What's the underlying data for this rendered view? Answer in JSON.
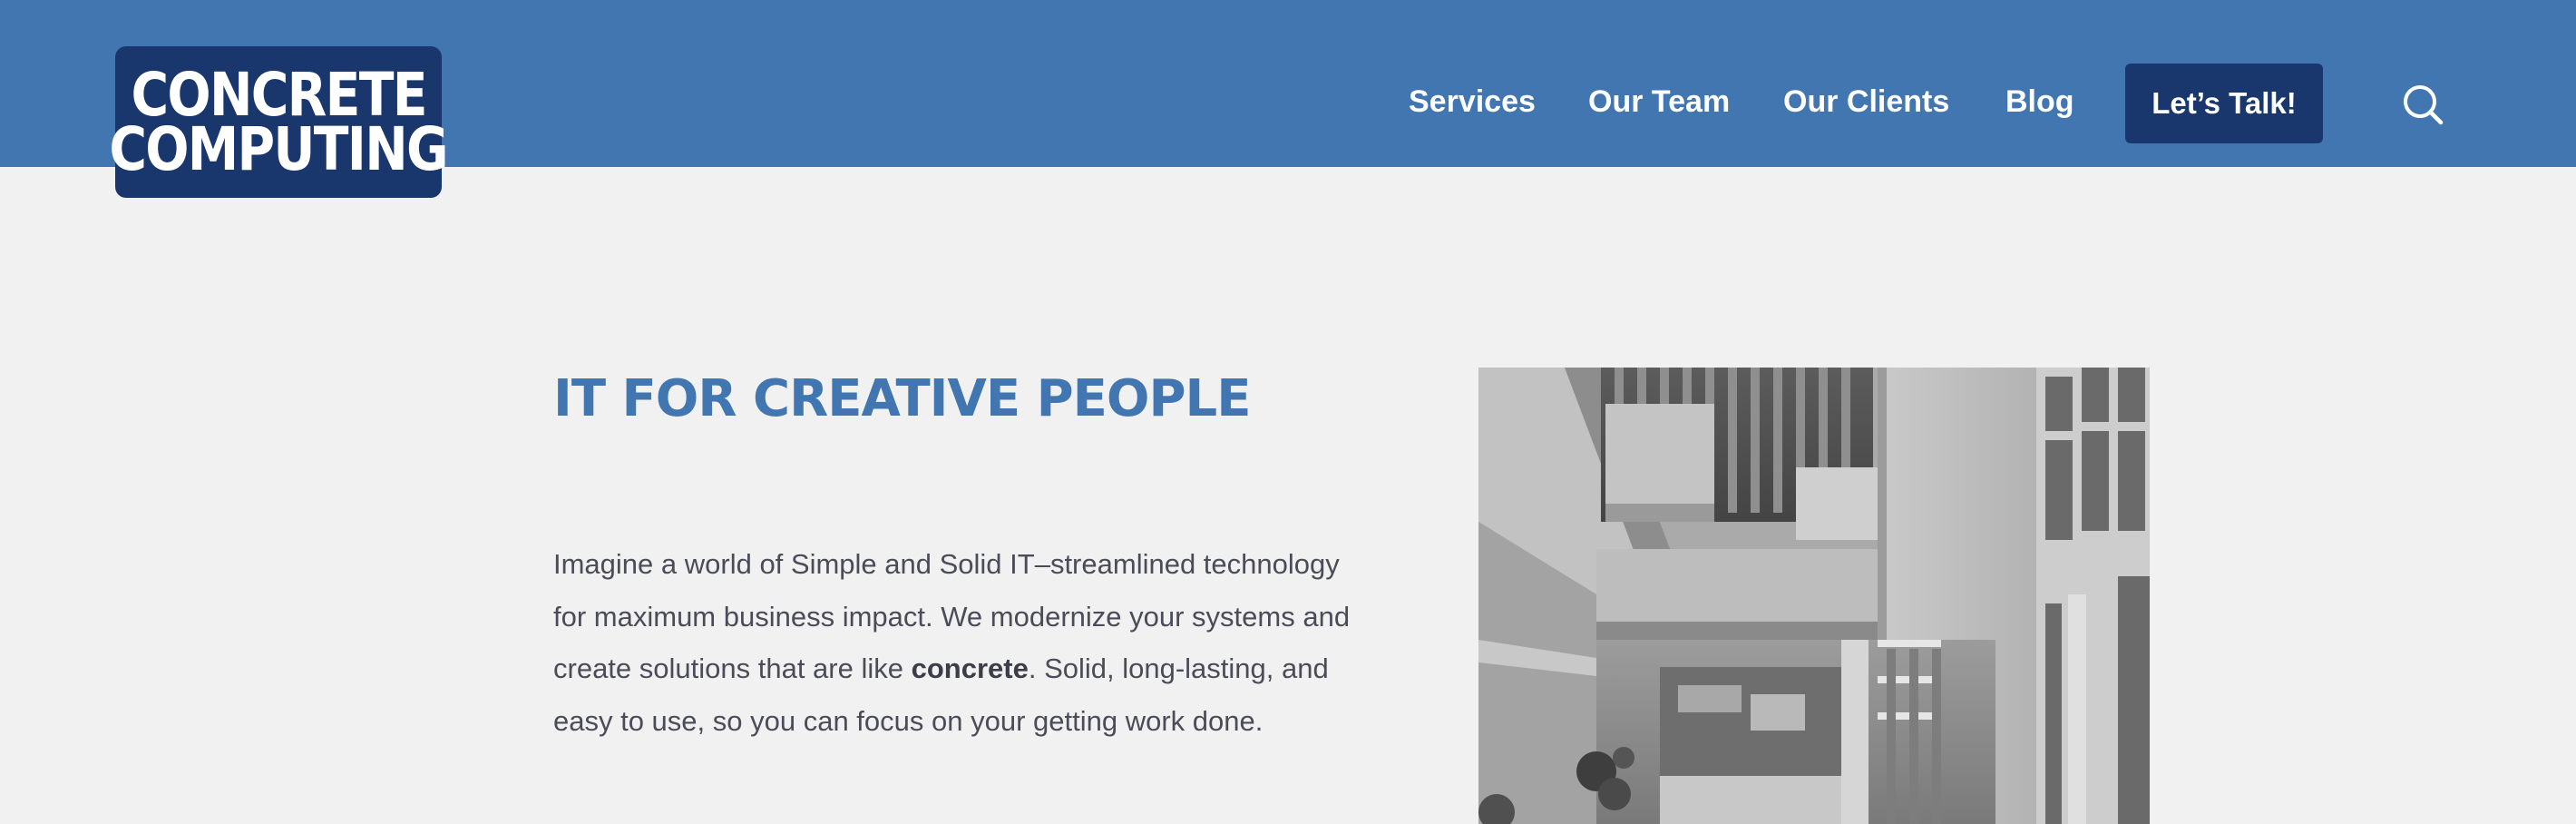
{
  "header": {
    "logo": {
      "line1": "CONCRETE",
      "line2": "COMPUTING"
    },
    "nav": [
      {
        "label": "Services"
      },
      {
        "label": "Our Team"
      },
      {
        "label": "Our Clients"
      },
      {
        "label": "Blog"
      }
    ],
    "cta_label": "Let’s Talk!",
    "search_icon": "search-icon"
  },
  "hero": {
    "title": "IT FOR CREATIVE PEOPLE",
    "body_before": "Imagine a world of Simple and Solid IT–streamlined technology for maximum business impact. We modernize your systems and create solutions that are like ",
    "body_bold": "concrete",
    "body_after": ". Solid, long-lasting, and easy to use, so you can focus on your getting work done.",
    "image_icon": "concrete-architecture-photo"
  },
  "colors": {
    "header_bg": "#4176b0",
    "logo_bg": "#19376c",
    "cta_bg": "#19376c",
    "page_bg": "#f1f1f1",
    "title": "#4176b0",
    "body_text": "#4c4c59"
  }
}
